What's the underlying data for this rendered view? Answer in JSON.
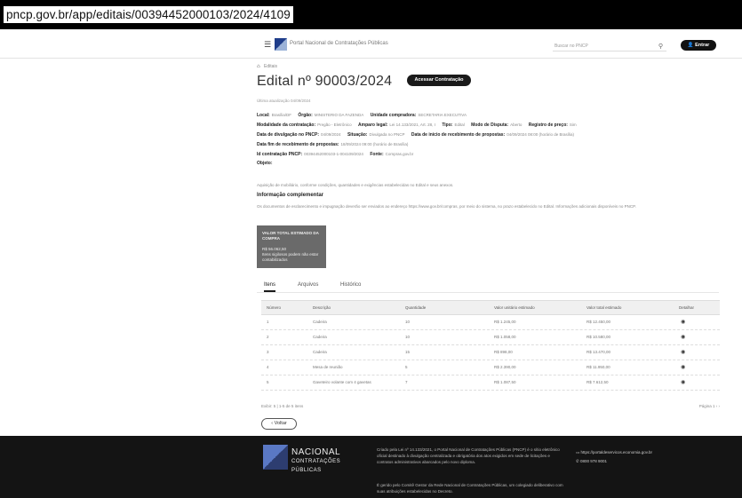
{
  "browser": {
    "url": "pncp.gov.br/app/editais/00394452000103/2024/4109"
  },
  "header": {
    "portal_title": "Portal Nacional de Contratações Públicas",
    "search_placeholder": "Buscar no PNCP",
    "login_label": "Entrar"
  },
  "breadcrumb": {
    "current": "Editais"
  },
  "page": {
    "title": "Edital nº 90003/2024",
    "access_button": "Acessar Contratação",
    "last_update": "Última atualização 04/09/2024"
  },
  "fields": {
    "row1": [
      {
        "label": "Local:",
        "value": "Brasília/DF"
      },
      {
        "label": "Órgão:",
        "value": "MINISTERIO DA FAZENDA"
      },
      {
        "label": "Unidade compradora:",
        "value": "SECRETARIA EXECUTIVA"
      }
    ],
    "row2": [
      {
        "label": "Modalidade da contratação:",
        "value": "Pregão - Eletrônico"
      },
      {
        "label": "Amparo legal:",
        "value": "Lei 14.133/2021, Art. 28, I"
      },
      {
        "label": "Tipo:",
        "value": "Edital"
      },
      {
        "label": "Modo de Disputa:",
        "value": "Aberto"
      },
      {
        "label": "Registro de preço:",
        "value": "Sim"
      }
    ],
    "row3": [
      {
        "label": "Data de divulgação no PNCP:",
        "value": "04/09/2024"
      },
      {
        "label": "Situação:",
        "value": "Divulgada no PNCP"
      },
      {
        "label": "Data de início de recebimento de propostas:",
        "value": "04/09/2024 08:00 (horário de Brasília)"
      }
    ],
    "row4": [
      {
        "label": "Data fim de recebimento de propostas:",
        "value": "18/09/2024 09:00 (horário de Brasília)"
      }
    ],
    "row5": [
      {
        "label": "Id contratação PNCP:",
        "value": "00394452000103-1-004109/2024"
      },
      {
        "label": "Fonte:",
        "value": "Compras.gov.br"
      }
    ],
    "objeto_label": "Objeto:",
    "objeto_value": "Aquisição de mobiliário, conforme condições, quantidades e exigências estabelecidas no Edital e seus anexos."
  },
  "info": {
    "title": "Informação complementar",
    "text": "Os documentos de esclarecimento e impugnação deverão ser enviados ao endereço https://www.gov.br/compras, por meio do sistema, no prazo estabelecido no Edital. Informações adicionais disponíveis no PNCP."
  },
  "total": {
    "label": "VALOR TOTAL ESTIMADO DA COMPRA",
    "value": "R$ 56.062,50",
    "note": "Itens sigilosos podem não estar contabilizados"
  },
  "tabs": [
    "Itens",
    "Arquivos",
    "Histórico"
  ],
  "table": {
    "headers": [
      "Número",
      "Descrição",
      "Quantidade",
      "Valor unitário estimado",
      "Valor total estimado",
      "Detalhar"
    ],
    "rows": [
      {
        "num": "1",
        "desc": "Cadeira",
        "qty": "10",
        "unit": "R$ 1.245,00",
        "total": "R$ 12.450,00"
      },
      {
        "num": "2",
        "desc": "Cadeira",
        "qty": "10",
        "unit": "R$ 1.058,00",
        "total": "R$ 10.580,00"
      },
      {
        "num": "3",
        "desc": "Cadeira",
        "qty": "15",
        "unit": "R$ 898,00",
        "total": "R$ 13.470,00"
      },
      {
        "num": "4",
        "desc": "Mesa de reunião",
        "qty": "5",
        "unit": "R$ 2.390,00",
        "total": "R$ 11.950,00"
      },
      {
        "num": "5",
        "desc": "Gaveteiro volante com 4 gavetas",
        "qty": "7",
        "unit": "R$ 1.087,50",
        "total": "R$ 7.612,50"
      }
    ]
  },
  "pager": {
    "left": "Exibir: 5 | 1-5 de 5 itens",
    "right": "Página 1 ‹ ›"
  },
  "back_button": "Voltar",
  "footer": {
    "logo_line1": "NACIONAL",
    "logo_line2": "CONTRATAÇÕES",
    "logo_line3": "PÚBLICAS",
    "text1": "Criado pela Lei nº 14.133/2021, o Portal Nacional de Contratações Públicas (PNCP) é o sítio eletrônico oficial destinado à divulgação centralizada e obrigatória dos atos exigidos em sede de licitações e contratos administrativos abarcados pelo novo diploma.",
    "text2": "É gerido pelo Comitê Gestor da Rede Nacional de Contratações Públicas, um colegiado deliberativo com suas atribuições estabelecidas no Decreto.",
    "contact_link": "https://portaldeservicos.economia.gov.br",
    "contact_phone": "0800 978 9001"
  }
}
